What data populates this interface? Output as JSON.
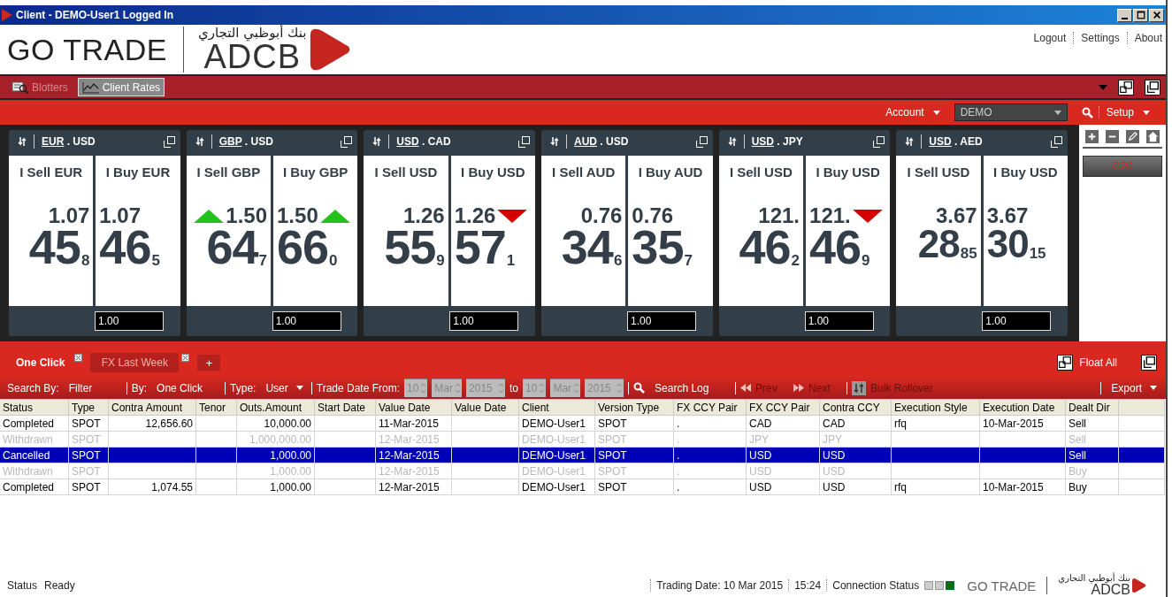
{
  "window": {
    "title": "Client - DEMO-User1 Logged In"
  },
  "header": {
    "brand": "GO TRADE",
    "bank_arabic": "بنك أبوظبي التجاري",
    "bank": "ADCB",
    "links": [
      "Logout",
      "Settings",
      "About"
    ]
  },
  "toolbar": {
    "tabs": [
      {
        "label": "Blotters",
        "selected": false
      },
      {
        "label": "Client Rates",
        "selected": true
      }
    ]
  },
  "account_bar": {
    "account_label": "Account",
    "account_value": "DEMO",
    "setup": "Setup"
  },
  "tiles": [
    {
      "base": "EUR",
      "separator": ".",
      "quote": "USD",
      "sides": [
        {
          "label": "I Sell EUR",
          "figure": "1.07",
          "pips": "45",
          "fraction": "8",
          "kind": "flat"
        },
        {
          "label": "I Buy EUR",
          "figure": "1.07",
          "pips": "46",
          "fraction": "5",
          "kind": "flat"
        }
      ],
      "amount": "1.00"
    },
    {
      "base": "GBP",
      "separator": ".",
      "quote": "USD",
      "sides": [
        {
          "label": "I Sell GBP",
          "figure": "1.50",
          "pips": "64",
          "fraction": "7",
          "kind": "up"
        },
        {
          "label": "I Buy GBP",
          "figure": "1.50",
          "pips": "66",
          "fraction": "0",
          "kind": "up"
        }
      ],
      "amount": "1.00"
    },
    {
      "base": "USD",
      "separator": ".",
      "quote": "CAD",
      "sides": [
        {
          "label": "I Sell USD",
          "figure": "1.26",
          "pips": "55",
          "fraction": "9",
          "kind": "flat"
        },
        {
          "label": "I Buy USD",
          "figure": "1.26",
          "pips": "57",
          "fraction": "1",
          "kind": "down"
        }
      ],
      "amount": "1.00"
    },
    {
      "base": "AUD",
      "separator": ".",
      "quote": "USD",
      "sides": [
        {
          "label": "I Sell AUD",
          "figure": "0.76",
          "pips": "34",
          "fraction": "6",
          "kind": "flat"
        },
        {
          "label": "I Buy AUD",
          "figure": "0.76",
          "pips": "35",
          "fraction": "7",
          "kind": "flat"
        }
      ],
      "amount": "1.00"
    },
    {
      "base": "USD",
      "separator": ".",
      "quote": "JPY",
      "sides": [
        {
          "label": "I Sell USD",
          "figure": "121.",
          "pips": "46",
          "fraction": "2",
          "kind": "flat"
        },
        {
          "label": "I Buy USD",
          "figure": "121.",
          "pips": "46",
          "fraction": "9",
          "kind": "down"
        }
      ],
      "amount": "1.00"
    },
    {
      "base": "USD",
      "separator": ".",
      "quote": "AED",
      "sides": [
        {
          "label": "I Sell USD",
          "figure": "3.67",
          "pips": "28",
          "fraction": "85",
          "kind": "flat"
        },
        {
          "label": "I Buy USD",
          "figure": "3.67",
          "pips": "30",
          "fraction": "15",
          "kind": "flat"
        }
      ],
      "amount": "1.00"
    }
  ],
  "side_panel": {
    "group_button": "G20"
  },
  "blotter": {
    "tabs": [
      {
        "label": "One Click",
        "selected": true
      },
      {
        "label": "FX Last Week",
        "selected": false
      }
    ],
    "add_tab": "+",
    "float_all": "Float All",
    "filters": {
      "search_by_label": "Search By:",
      "search_by_value": "Filter",
      "by_label": "By:",
      "by_value": "One Click",
      "type_label": "Type:",
      "type_value": "User",
      "trade_date_label": "Trade Date From:",
      "from": {
        "day": "10",
        "month": "Mar",
        "year": "2015"
      },
      "to_label": "to",
      "to": {
        "day": "10",
        "month": "Mar",
        "year": "2015"
      },
      "search_log": "Search Log",
      "prev": "Prev",
      "next": "Next",
      "bulk_rollover": "Bulk Rollover",
      "export": "Export"
    }
  },
  "table": {
    "columns": [
      {
        "label": "Status"
      },
      {
        "label": "Type"
      },
      {
        "label": "Contra Amount",
        "numeric": true
      },
      {
        "label": "Tenor"
      },
      {
        "label": "Outs.Amount",
        "numeric": true
      },
      {
        "label": "Start Date"
      },
      {
        "label": "Value Date"
      },
      {
        "label": "Value Date"
      },
      {
        "label": "Client"
      },
      {
        "label": "Version Type"
      },
      {
        "label": "FX CCY Pair"
      },
      {
        "label": "FX CCY Pair"
      },
      {
        "label": "Contra CCY"
      },
      {
        "label": "Execution Style"
      },
      {
        "label": "Execution Date"
      },
      {
        "label": "Dealt Dir"
      }
    ],
    "rows": [
      {
        "selected": false,
        "disabled": false,
        "cells": [
          "Completed",
          "SPOT",
          "12,656.60",
          "",
          "10,000.00",
          "",
          "11-Mar-2015",
          "",
          "DEMO-User1",
          "SPOT",
          ".",
          "CAD",
          "CAD",
          "rfq",
          "10-Mar-2015",
          "Sell"
        ]
      },
      {
        "selected": false,
        "disabled": true,
        "cells": [
          "Withdrawn",
          "SPOT",
          "",
          "",
          "1,000,000.00",
          "",
          "12-Mar-2015",
          "",
          "DEMO-User1",
          "SPOT",
          ".",
          "JPY",
          "JPY",
          "",
          "",
          "Sell"
        ]
      },
      {
        "selected": true,
        "disabled": false,
        "cells": [
          "Cancelled",
          "SPOT",
          "",
          "",
          "1,000.00",
          "",
          "12-Mar-2015",
          "",
          "DEMO-User1",
          "SPOT",
          ".",
          "USD",
          "USD",
          "",
          "",
          "Sell"
        ]
      },
      {
        "selected": false,
        "disabled": true,
        "cells": [
          "Withdrawn",
          "SPOT",
          "",
          "",
          "1,000.00",
          "",
          "12-Mar-2015",
          "",
          "DEMO-User1",
          "SPOT",
          ".",
          "USD",
          "USD",
          "",
          "",
          "Buy"
        ]
      },
      {
        "selected": false,
        "disabled": false,
        "cells": [
          "Completed",
          "SPOT",
          "1,074.55",
          "",
          "1,000.00",
          "",
          "12-Mar-2015",
          "",
          "DEMO-User1",
          "SPOT",
          ".",
          "USD",
          "USD",
          "rfq",
          "10-Mar-2015",
          "Buy"
        ]
      }
    ]
  },
  "status_bar": {
    "label": "Status",
    "value": "Ready",
    "trading_date": "Trading Date: 10 Mar 2015",
    "time": "15:24",
    "connection_label": "Connection Status",
    "connection_lights": [
      {
        "on": false
      },
      {
        "on": false
      },
      {
        "on": true
      }
    ],
    "brand": "GO TRADE",
    "bank_arabic": "بنك أبوظبي التجاري",
    "bank": "ADCB"
  }
}
